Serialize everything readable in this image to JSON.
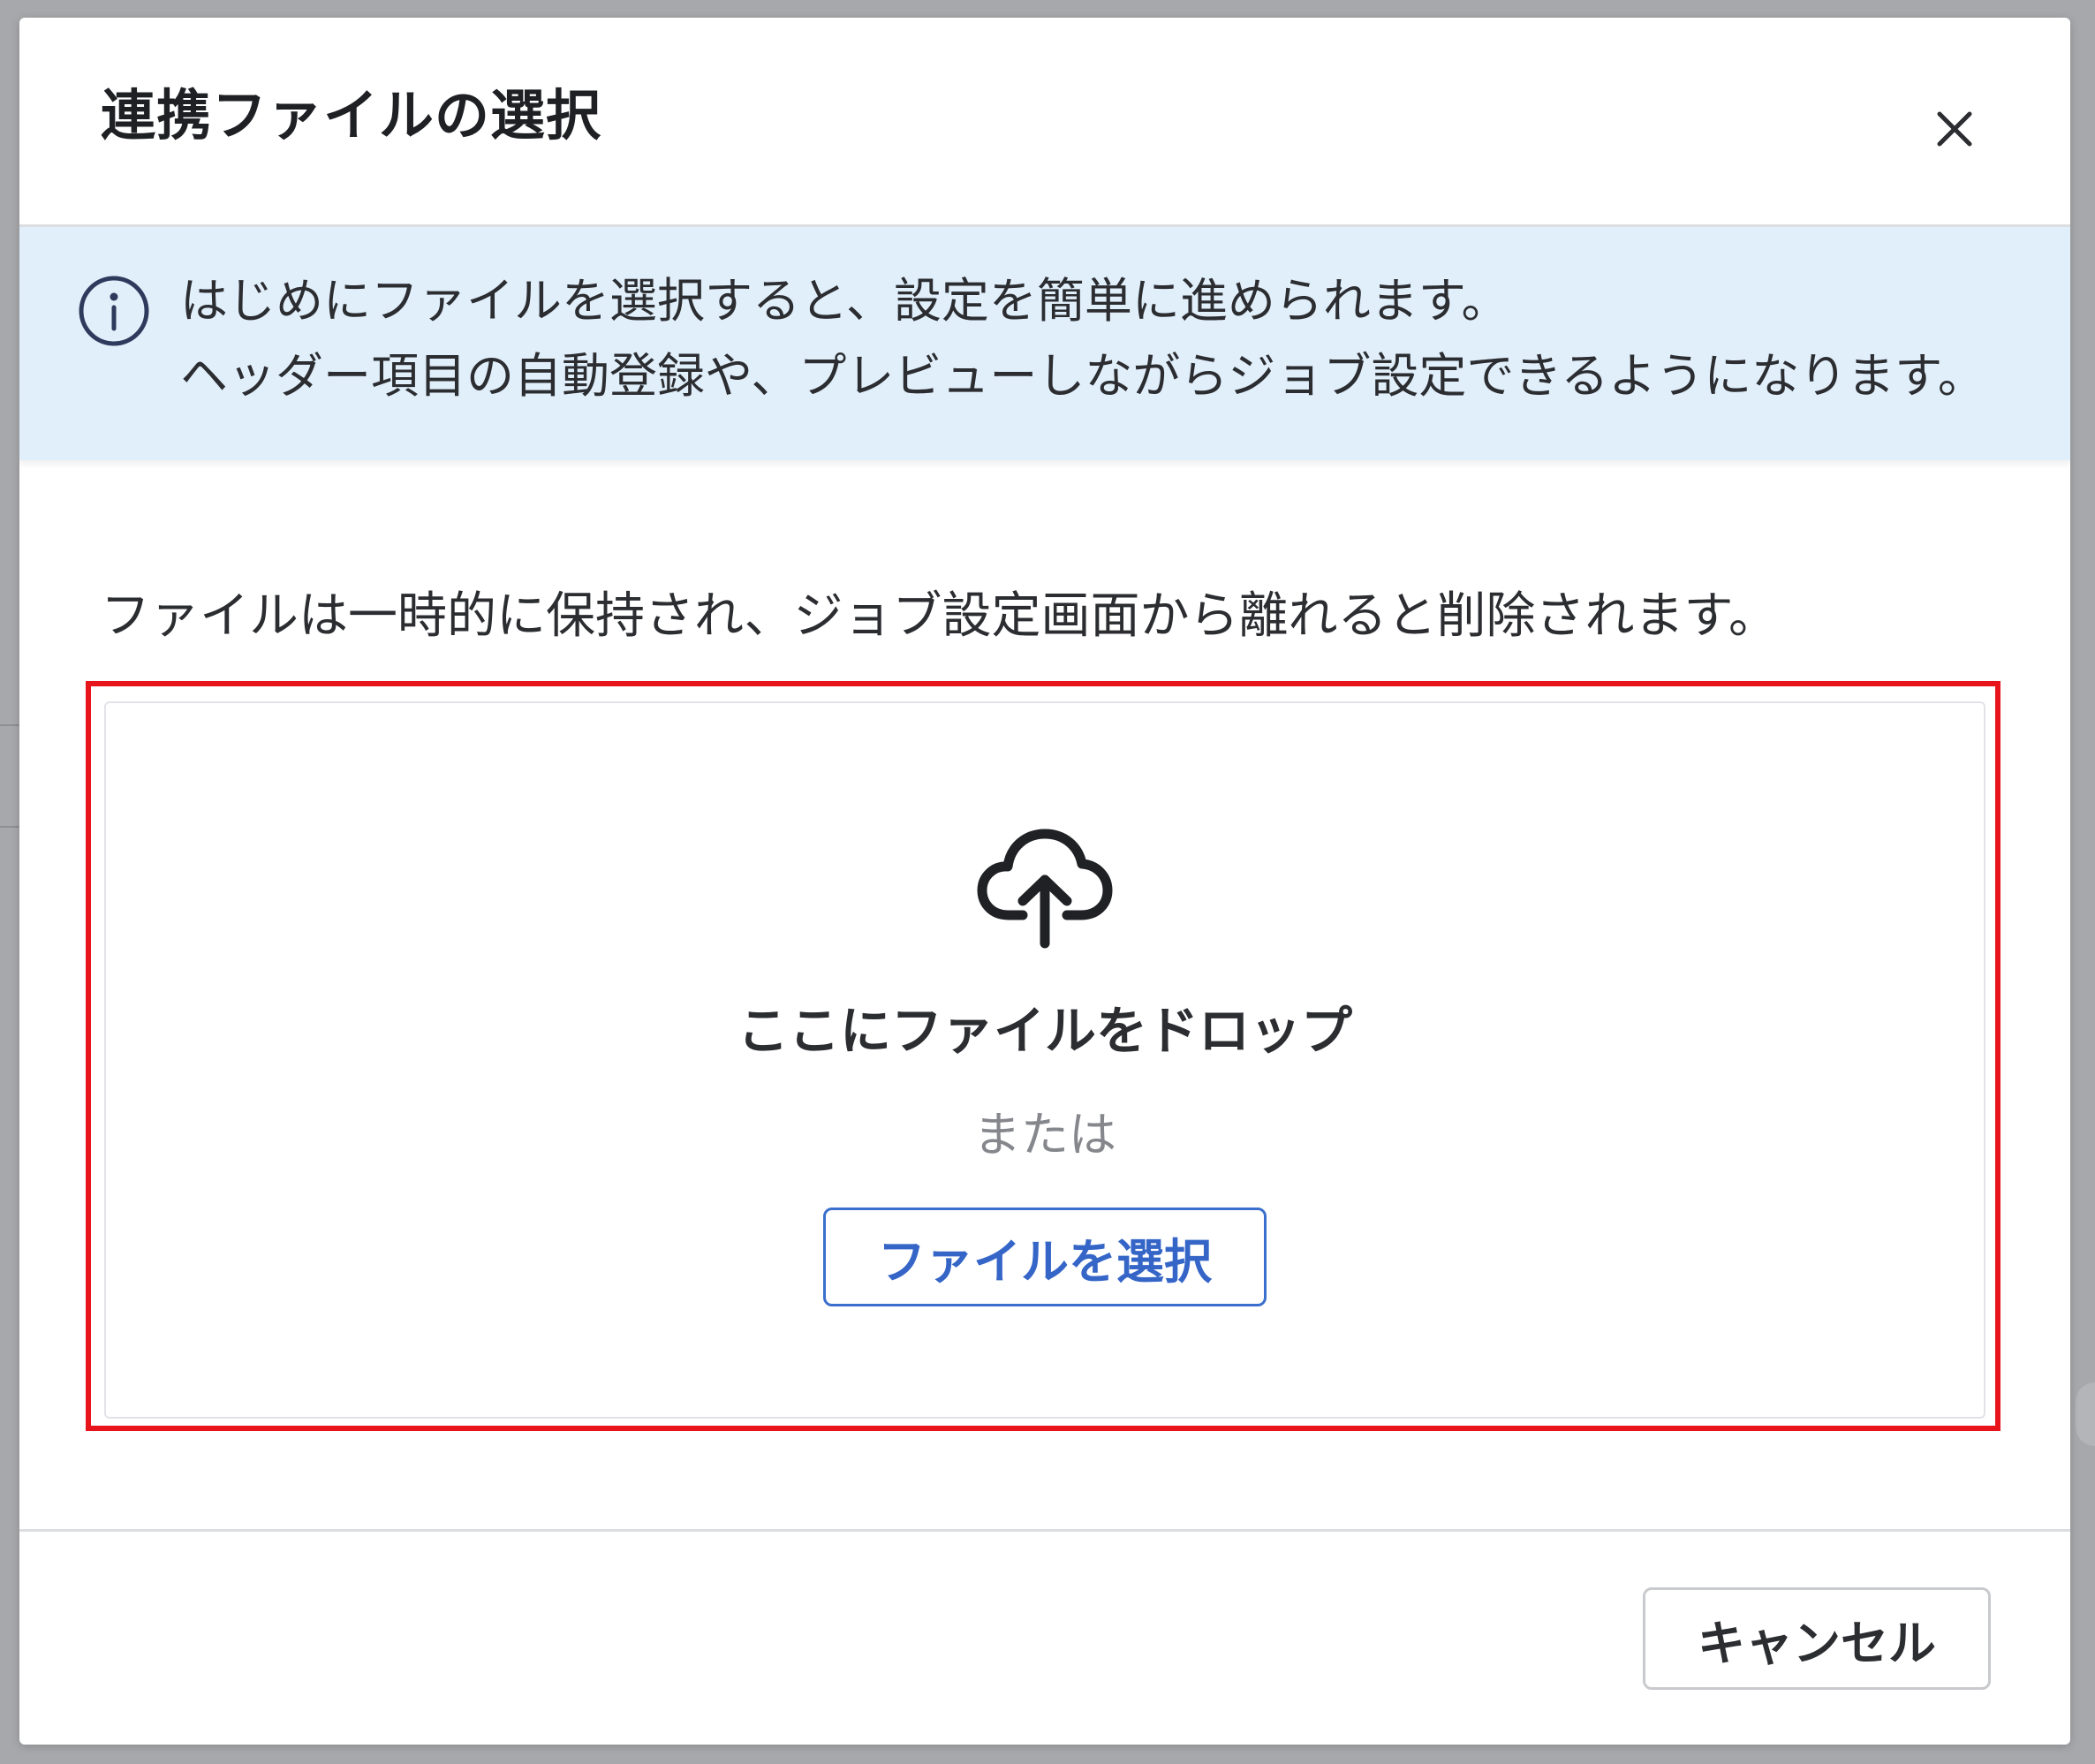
{
  "modal": {
    "title": "連携ファイルの選択",
    "close_icon": "close-icon"
  },
  "info": {
    "icon": "info-icon",
    "line1": "はじめにファイルを選択すると、設定を簡単に進められます。",
    "line2": "ヘッダー項目の自動登録や、プレビューしながらジョブ設定できるようになります。"
  },
  "note": "ファイルは一時的に保持され、ジョブ設定画面から離れると削除されます。",
  "dropzone": {
    "icon": "cloud-upload-icon",
    "title": "ここにファイルをドロップ",
    "or": "または",
    "select_button": "ファイルを選択"
  },
  "footer": {
    "cancel_button": "キャンセル"
  },
  "colors": {
    "highlight": "#e8141b",
    "info_background": "#e1effb",
    "primary": "#3566c7"
  }
}
